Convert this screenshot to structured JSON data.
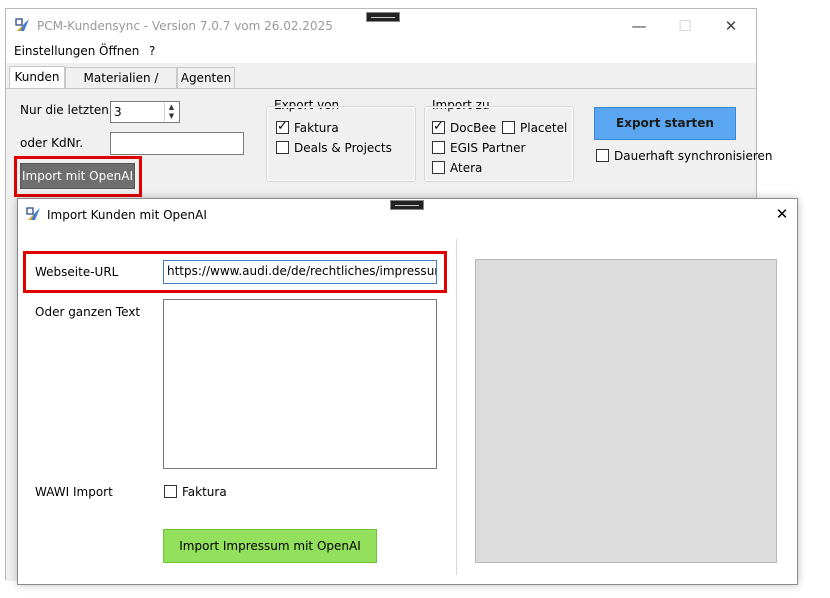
{
  "main_window": {
    "title": "PCM-Kundensync - Version 7.0.7 vom 26.02.2025",
    "controls": {
      "minimize": "—",
      "maximize": "☐",
      "close": "✕"
    }
  },
  "menu": [
    "Einstellungen",
    "Öffnen",
    "?"
  ],
  "tabs": [
    {
      "label": "Kunden",
      "active": true
    },
    {
      "label": "Materialien / Artikel",
      "active": false
    },
    {
      "label": "Agenten",
      "active": false
    }
  ],
  "kunden": {
    "nur_letzten_label": "Nur die letzten",
    "nur_letzten_value": "3",
    "kdnr_label": "oder KdNr.",
    "kdnr_value": "",
    "import_openai_button": "Import mit OpenAI",
    "export_von": {
      "legend": "Export von",
      "options": [
        {
          "label": "Faktura",
          "checked": true
        },
        {
          "label": "Deals & Projects",
          "checked": false
        }
      ]
    },
    "import_zu": {
      "legend": "Import zu",
      "docbee": {
        "label": "DocBee",
        "checked": true
      },
      "placetel": {
        "label": "Placetel",
        "checked": false
      },
      "egis": {
        "label": "EGIS Partner",
        "checked": false
      },
      "atera": {
        "label": "Atera",
        "checked": false
      }
    },
    "export_button": "Export starten",
    "dauerhaft": {
      "label": "Dauerhaft synchronisieren",
      "checked": false
    }
  },
  "dialog": {
    "title": "Import Kunden mit OpenAI",
    "close": "✕",
    "webseite_label": "Webseite-URL",
    "webseite_value": "https://www.audi.de/de/rechtliches/impressum/",
    "text_label": "Oder ganzen Text",
    "text_value": "",
    "wawi_label": "WAWI Import",
    "wawi_faktura": {
      "label": "Faktura",
      "checked": false
    },
    "import_button": "Import Impressum mit OpenAI"
  },
  "colors": {
    "highlight": "#e00000",
    "export_button": "#5aa6f0",
    "import_button": "#92e05c",
    "gray_button": "#6e6e6e"
  }
}
